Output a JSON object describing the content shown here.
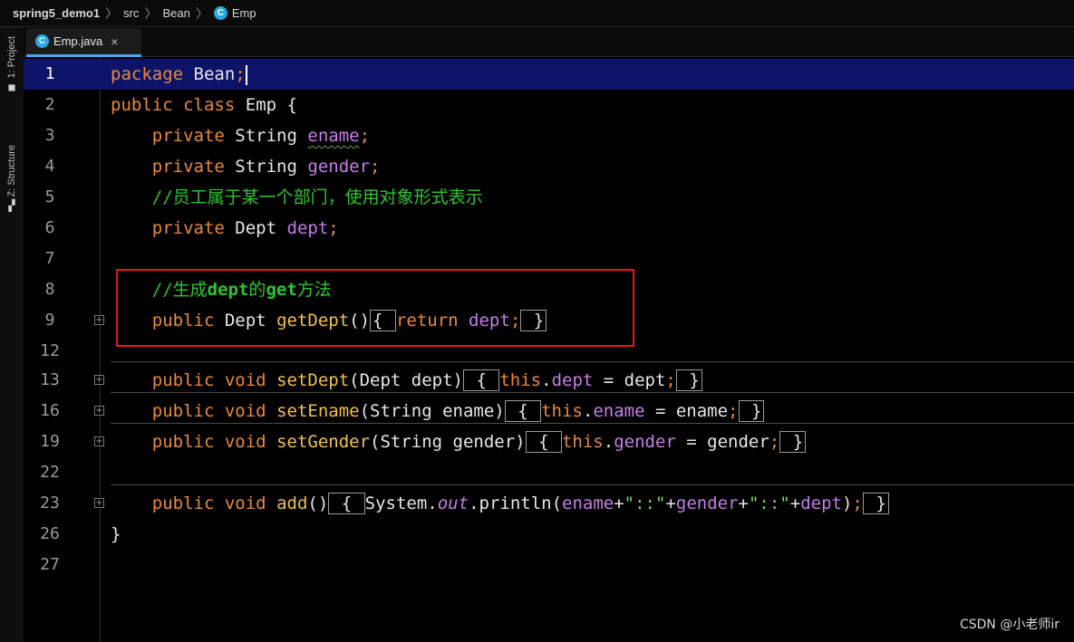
{
  "breadcrumb": [
    "spring5_demo1",
    "src",
    "Bean",
    "Emp"
  ],
  "sidebar": {
    "project_label": "1: Project",
    "structure_label": "Z: Structure"
  },
  "tab": {
    "icon_letter": "C",
    "label": "Emp.java",
    "close": "×"
  },
  "line_numbers": [
    "1",
    "2",
    "3",
    "4",
    "5",
    "6",
    "7",
    "8",
    "9",
    "12",
    "13",
    "16",
    "19",
    "22",
    "23",
    "26",
    "27"
  ],
  "code": {
    "line1": {
      "kw": "package",
      "name": "Bean",
      "semi": ";"
    },
    "line2": {
      "kw1": "public",
      "kw2": "class",
      "name": "Emp",
      "brace": "{"
    },
    "line3": {
      "kw": "private",
      "type": "String",
      "field": "ename",
      "semi": ";"
    },
    "line4": {
      "kw": "private",
      "type": "String",
      "field": "gender",
      "semi": ";"
    },
    "line5": {
      "comment": "//员工属于某一个部门，使用对象形式表示"
    },
    "line6": {
      "kw": "private",
      "type": "Dept",
      "field": "dept",
      "semi": ";"
    },
    "line8": {
      "prefix": "//生成",
      "b1": "dept",
      "mid": "的",
      "b2": "get",
      "suffix": "方法"
    },
    "line9": {
      "kw": "public",
      "type": "Dept",
      "method": "getDept",
      "parens": "()",
      "open": "{",
      "ret": "return",
      "field": "dept",
      "semi": ";",
      "close": "}"
    },
    "line13": {
      "kw1": "public",
      "kw2": "void",
      "method": "setDept",
      "params": "(Dept dept)",
      "open": "{",
      "this": "this",
      "dot": ".",
      "field": "dept",
      "assign": " = dept",
      "semi": ";",
      "close": "}"
    },
    "line16": {
      "kw1": "public",
      "kw2": "void",
      "method": "setEname",
      "params": "(String ename)",
      "open": "{",
      "this": "this",
      "dot": ".",
      "field": "ename",
      "assign": " = ename",
      "semi": ";",
      "close": "}"
    },
    "line19": {
      "kw1": "public",
      "kw2": "void",
      "method": "setGender",
      "params": "(String gender)",
      "open": "{",
      "this": "this",
      "dot": ".",
      "field": "gender",
      "assign": " = gender",
      "semi": ";",
      "close": "}"
    },
    "line23": {
      "kw1": "public",
      "kw2": "void",
      "method": "add",
      "parens": "()",
      "open": "{",
      "sys": "System.",
      "out": "out",
      "call": ".println(",
      "f1": "ename",
      "plus1": "+",
      "s1": "\"::\"",
      "plus2": "+",
      "f2": "gender",
      "plus3": "+",
      "s2": "\"::\"",
      "plus4": "+",
      "f3": "dept",
      "rp": ")",
      "semi": ";",
      "close": "}"
    },
    "line26": {
      "brace": "}"
    }
  },
  "watermark": "CSDN @小老师ir"
}
